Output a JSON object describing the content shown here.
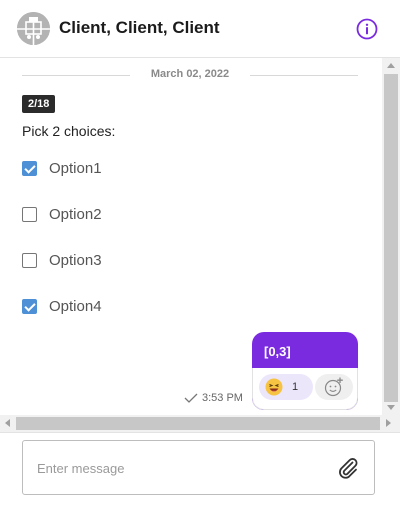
{
  "header": {
    "title": "Client, Client, Client",
    "avatar_icon": "group-avatar-icon",
    "info_icon": "info-icon",
    "accent_color": "#7a2be0"
  },
  "chat": {
    "date_separator": "March 02, 2022",
    "poll": {
      "counter": "2/18",
      "question": "Pick 2 choices:",
      "options": [
        {
          "label": "Option1",
          "checked": true
        },
        {
          "label": "Option2",
          "checked": false
        },
        {
          "label": "Option3",
          "checked": false
        },
        {
          "label": "Option4",
          "checked": true
        }
      ],
      "checkbox_color": "#4d90d6"
    },
    "outgoing_message": {
      "text": "[0,3]",
      "bubble_color": "#7a2be0",
      "reaction": {
        "emoji_icon": "laughing-emoji-icon",
        "count": "1"
      },
      "add_reaction_icon": "add-reaction-icon",
      "status_icon": "check-icon",
      "time": "3:53 PM"
    }
  },
  "composer": {
    "placeholder": "Enter message",
    "value": "",
    "attach_icon": "paperclip-icon"
  }
}
